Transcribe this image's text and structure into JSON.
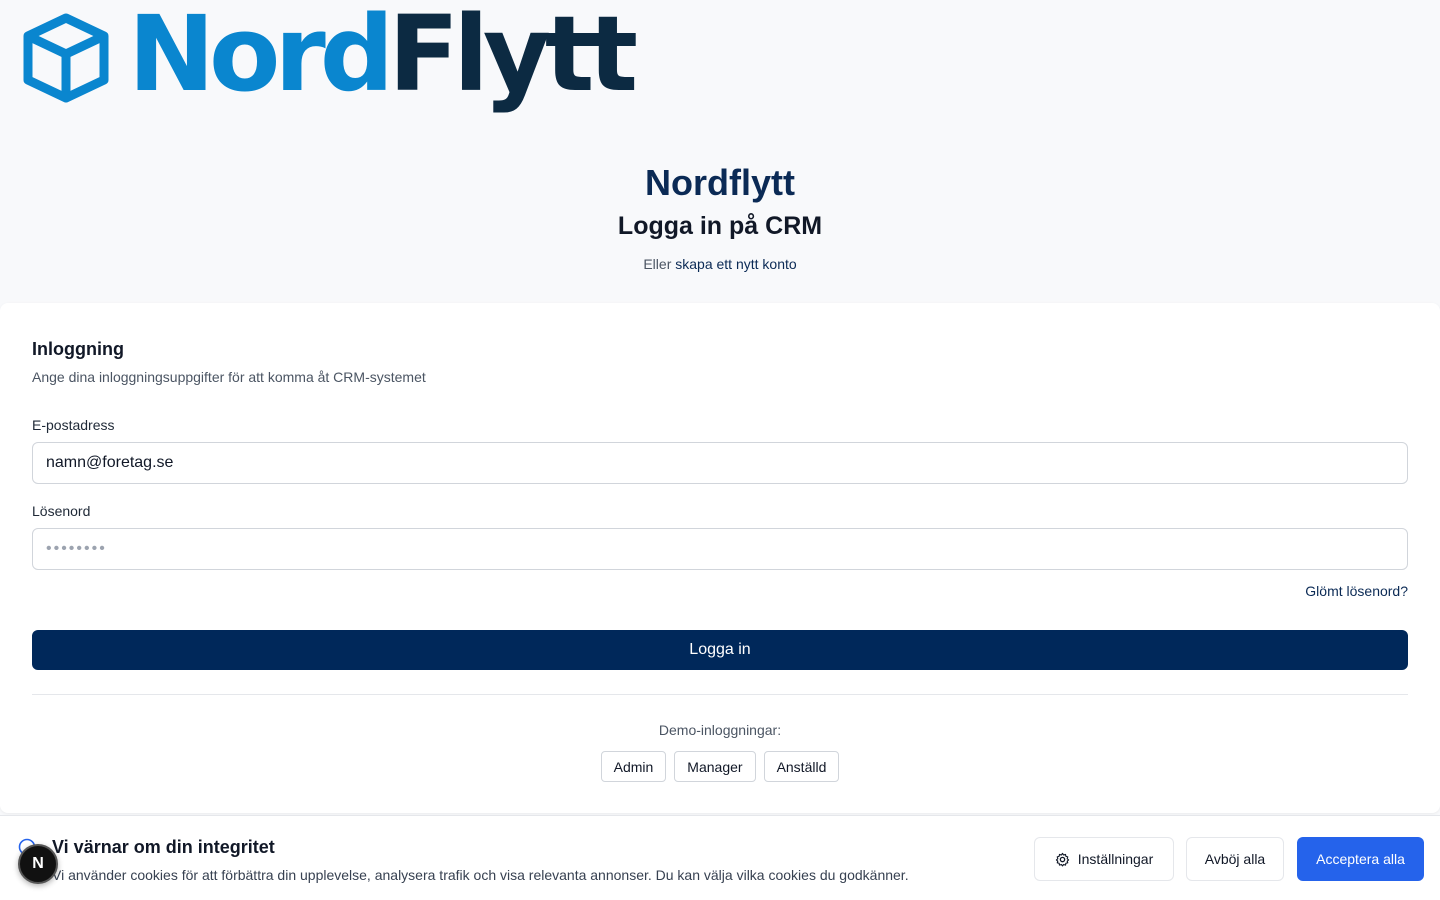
{
  "logo": {
    "part1": "Nord",
    "part2": "Flytt"
  },
  "header": {
    "brand": "Nordflytt",
    "title": "Logga in på CRM",
    "alt_prefix": "Eller",
    "alt_link": "skapa ett nytt konto"
  },
  "login": {
    "title": "Inloggning",
    "description": "Ange dina inloggningsuppgifter för att komma åt CRM-systemet",
    "email_label": "E-postadress",
    "email_placeholder": "namn@foretag.se",
    "password_label": "Lösenord",
    "password_placeholder": "••••••••",
    "forgot": "Glömt lösenord?",
    "submit": "Logga in",
    "demo_label": "Demo-inloggningar:",
    "demo_buttons": [
      "Admin",
      "Manager",
      "Anställd"
    ]
  },
  "cookie": {
    "title": "Vi värnar om din integritet",
    "text": "Vi använder cookies för att förbättra din upplevelse, analysera trafik och visa relevanta annonser. Du kan välja vilka cookies du godkänner.",
    "settings": "Inställningar",
    "reject": "Avböj alla",
    "accept": "Acceptera alla"
  },
  "badge": "N",
  "colors": {
    "brand_blue": "#0a86cf",
    "brand_dark": "#0c2a42",
    "primary_navy": "#00285a",
    "accept_blue": "#2563eb"
  },
  "icons": [
    "box-logo-icon",
    "cookie-icon",
    "gear-icon"
  ]
}
